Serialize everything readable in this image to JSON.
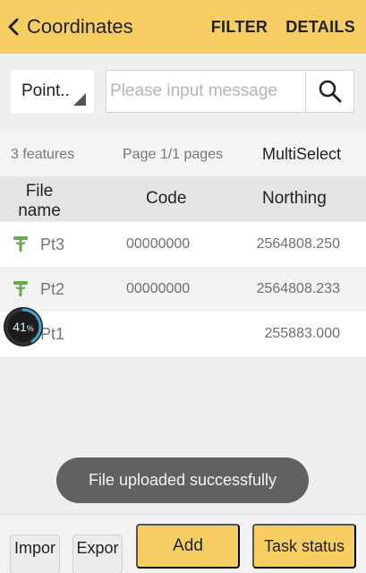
{
  "header": {
    "title": "Coordinates",
    "actions": [
      "FILTER",
      "DETAILS"
    ]
  },
  "search": {
    "type_value": "Point..",
    "placeholder": "Please input message"
  },
  "info": {
    "feature_count": "3 features",
    "page": "Page 1/1 pages",
    "multiselect": "MultiSelect"
  },
  "table": {
    "columns": [
      "File name",
      "Code",
      "Northing"
    ],
    "rows": [
      {
        "name": "Pt3",
        "code": "00000000",
        "northing": "2564808.250",
        "icon": "survey-point-icon"
      },
      {
        "name": "Pt2",
        "code": "00000000",
        "northing": "2564808.233",
        "icon": "survey-point-icon"
      },
      {
        "name": "Pt1",
        "code": "",
        "northing": "255883.000",
        "icon": ""
      }
    ]
  },
  "progress": {
    "value": "41",
    "unit": "%"
  },
  "toast": "File uploaded successfully",
  "bottom": {
    "import": "Impor",
    "export": "Expor",
    "add": "Add",
    "task_status": "Task status"
  },
  "colors": {
    "accent": "#f6cd63",
    "point_icon": "#6aa84f",
    "toast_bg": "#616161"
  }
}
